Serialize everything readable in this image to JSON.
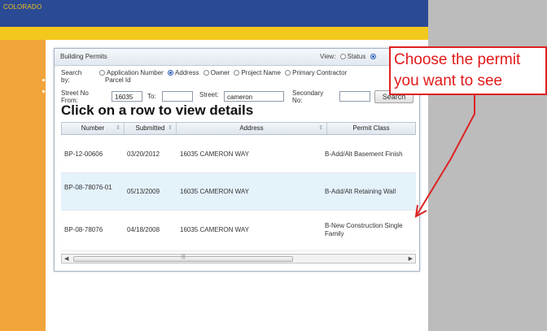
{
  "header": {
    "brand": "COLORADO"
  },
  "panel": {
    "title": "Building Permits",
    "view_label": "View:",
    "view_options": [
      "Status",
      ""
    ]
  },
  "search": {
    "by_label": "Search by:",
    "options": [
      "Application Number",
      "Address",
      "Owner",
      "Project Name",
      "Primary Contractor"
    ],
    "selected": "Address",
    "extra_option": "Parcel Id",
    "street_no_from_label": "Street No From:",
    "street_no_from_value": "16035",
    "to_label": "To:",
    "to_value": "",
    "street_label": "Street:",
    "street_value": "cameron",
    "secondary_label": "Secondary No:",
    "secondary_value": "",
    "button": "Search"
  },
  "instruction": "Click on a row to view details",
  "table": {
    "columns": [
      "Number",
      "Submitted",
      "Address",
      "Permit Class"
    ],
    "rows": [
      {
        "number": "BP-12-00606",
        "submitted": "03/20/2012",
        "address": "16035 CAMERON WAY",
        "permit_class": "B-Add/Alt Basement Finish"
      },
      {
        "number": "BP-08-78076-01",
        "submitted": "05/13/2009",
        "address": "16035 CAMERON WAY",
        "permit_class": "B-Add/Alt Retaining Wall"
      },
      {
        "number": "BP-08-78076",
        "submitted": "04/18/2008",
        "address": "16035 CAMERON WAY",
        "permit_class": "B-New Construction Single Family"
      }
    ]
  },
  "annotation": {
    "line1": "Choose the permit",
    "line2": "you want to see",
    "color": "#dd2222"
  },
  "colors": {
    "header_blue": "#2b4a94",
    "header_yellow": "#f3c81c",
    "sidebar_orange": "#f0a43a",
    "row_highlight": "#e4f2fa"
  }
}
